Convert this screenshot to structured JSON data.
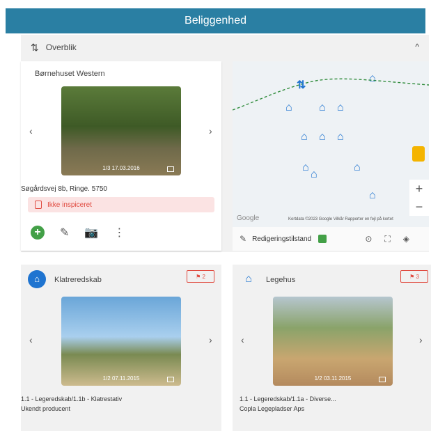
{
  "header": {
    "title": "Beliggenhed"
  },
  "overview": {
    "label": "Overblik",
    "icon": "signpost-icon",
    "chevron": "^"
  },
  "location_card": {
    "name": "Børnehuset Western",
    "photo_caption": "1/3   17.03.2016",
    "address": "Søgårdsvej 8b, Ringe. 5750",
    "status": "Ikke inspiceret",
    "actions": {
      "add": "+",
      "edit": "✎",
      "camera": "📷",
      "more": "⋮"
    }
  },
  "map": {
    "logo": "Google",
    "attribution": "Kortdata ©2023 Google   Vilkår   Rapporter en fejl på kortet",
    "edit_label": "Redigeringstilstand",
    "zoom_in": "+",
    "zoom_out": "−"
  },
  "items": [
    {
      "title": "Klatreredskab",
      "flag_count": "2",
      "photo_caption": "1/2   07.11.2015",
      "path": "1.1 - Legeredskab/1.1b - Klatrestativ",
      "producer": "Ukendt producent"
    },
    {
      "title": "Legehus",
      "flag_count": "3",
      "photo_caption": "1/2   03.11.2015",
      "path": "1.1 - Legeredskab/1.1a - Diverse...",
      "producer": "Copla Legepladser Aps"
    }
  ]
}
